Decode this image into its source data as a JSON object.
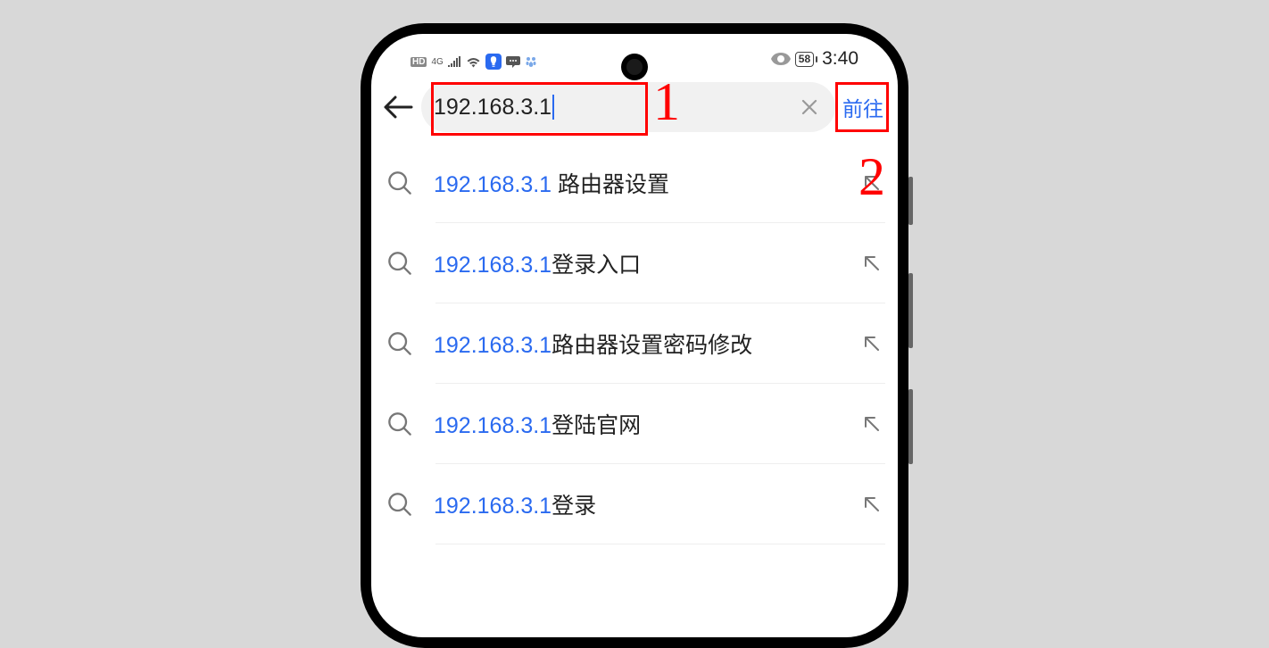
{
  "status_bar": {
    "network_badge": "HD",
    "network_type": "4G",
    "battery_percent": "58",
    "time": "3:40"
  },
  "address_bar": {
    "value": "192.168.3.1",
    "go_button": "前往"
  },
  "annotations": {
    "label1": "1",
    "label2": "2"
  },
  "suggestions": [
    {
      "url": "192.168.3.1 ",
      "suffix": "路由器设置"
    },
    {
      "url": "192.168.3.1",
      "suffix": "登录入口"
    },
    {
      "url": "192.168.3.1",
      "suffix": "路由器设置密码修改"
    },
    {
      "url": "192.168.3.1",
      "suffix": "登陆官网"
    },
    {
      "url": "192.168.3.1",
      "suffix": "登录"
    }
  ]
}
